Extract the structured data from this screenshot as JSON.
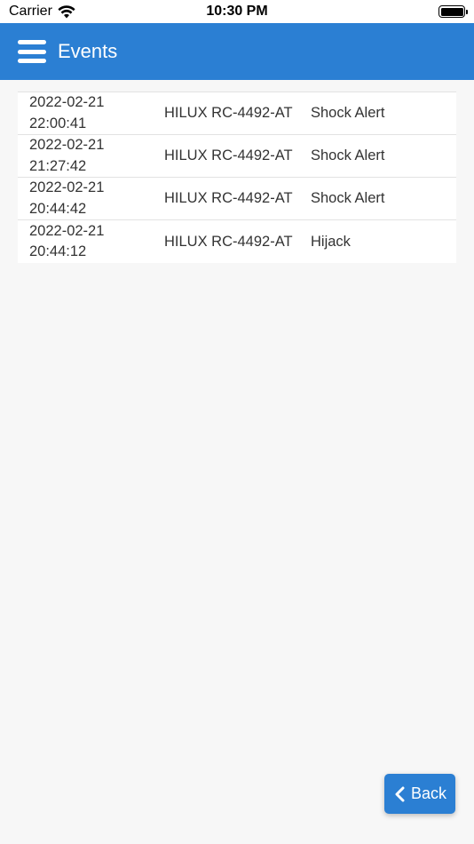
{
  "status_bar": {
    "carrier": "Carrier",
    "time": "10:30 PM"
  },
  "header": {
    "title": "Events",
    "menu_icon": "hamburger-icon",
    "background_color": "#2b7fd3"
  },
  "events": [
    {
      "date": "2022-02-21",
      "time": "22:00:41",
      "vehicle": "HILUX RC-4492-AT",
      "type": "Shock Alert"
    },
    {
      "date": "2022-02-21",
      "time": "21:27:42",
      "vehicle": "HILUX RC-4492-AT",
      "type": "Shock Alert"
    },
    {
      "date": "2022-02-21",
      "time": "20:44:42",
      "vehicle": "HILUX RC-4492-AT",
      "type": "Shock Alert"
    },
    {
      "date": "2022-02-21",
      "time": "20:44:12",
      "vehicle": "HILUX RC-4492-AT",
      "type": "Hijack"
    }
  ],
  "back_button": {
    "label": "Back",
    "icon": "chevron-left-icon"
  }
}
